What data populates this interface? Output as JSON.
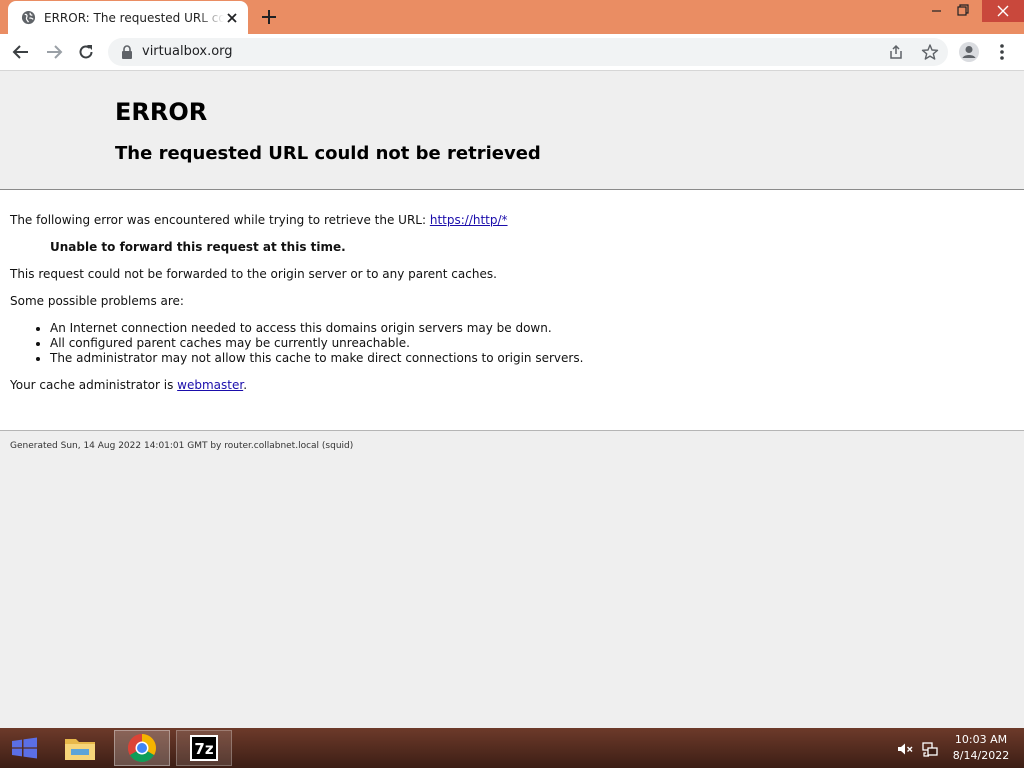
{
  "browser": {
    "tab_title": "ERROR: The requested URL could not be retrieved",
    "url": "virtualbox.org"
  },
  "page": {
    "heading": "ERROR",
    "subheading": "The requested URL could not be retrieved",
    "intro_text": "The following error was encountered while trying to retrieve the URL: ",
    "intro_link": "https://http/*",
    "error_message": "Unable to forward this request at this time.",
    "forward_text": "This request could not be forwarded to the origin server or to any parent caches.",
    "problems_intro": "Some possible problems are:",
    "problems": [
      "An Internet connection needed to access this domains origin servers may be down.",
      "All configured parent caches may be currently unreachable.",
      "The administrator may not allow this cache to make direct connections to origin servers."
    ],
    "admin_text": "Your cache administrator is ",
    "admin_link": "webmaster",
    "admin_suffix": ".",
    "footer": "Generated Sun, 14 Aug 2022 14:01:01 GMT by router.collabnet.local (squid)"
  },
  "taskbar": {
    "clock_time": "10:03 AM",
    "clock_date": "8/14/2022",
    "seven_zip_label": "7z"
  },
  "colors": {
    "titlebar": "#ea8d63",
    "close_button": "#c9483c",
    "link": "#1a0dab",
    "taskbar": "#5a2e22"
  }
}
